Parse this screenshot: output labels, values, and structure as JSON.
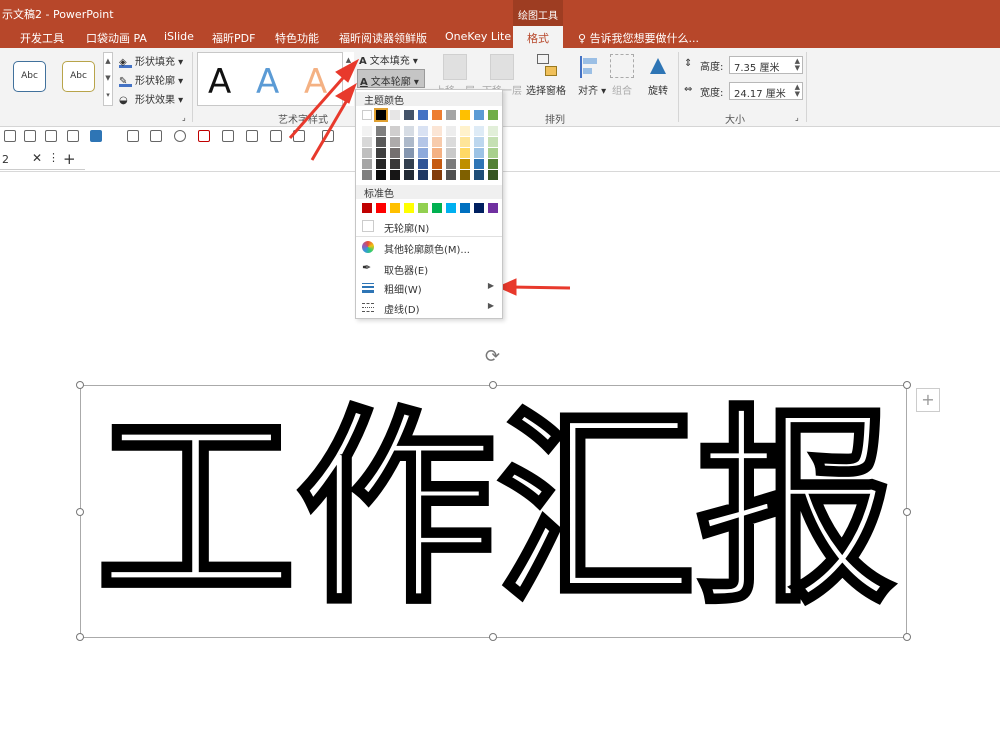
{
  "titlebar": {
    "title": "示文稿2 - PowerPoint",
    "context_group": "绘图工具"
  },
  "tabs": [
    "开发工具",
    "口袋动画 PA",
    "iSlide",
    "福昕PDF",
    "特色功能",
    "福昕阅读器领鲜版",
    "OneKey Lite"
  ],
  "active_tab": "格式",
  "tell_me": "告诉我您想要做什么...",
  "ribbon": {
    "shape_styles": {
      "sample1": "Abc",
      "sample2": "Abc",
      "fill": "形状填充",
      "outline": "形状轮廓",
      "effects": "形状效果"
    },
    "wordart": {
      "letter": "A",
      "label": "艺术字样式",
      "text_fill": "文本填充",
      "text_outline": "文本轮廓"
    },
    "arrange": {
      "bring_forward": "上移一层",
      "send_backward": "下移一层",
      "selection_pane": "选择窗格",
      "align": "对齐",
      "group": "组合",
      "rotate": "旋转",
      "label": "排列"
    },
    "size": {
      "height_label": "高度:",
      "height_value": "7.35 厘米",
      "width_label": "宽度:",
      "width_value": "24.17 厘米",
      "label": "大小"
    }
  },
  "doc_tab": {
    "name": "2"
  },
  "menu": {
    "theme_header": "主题颜色",
    "standard_header": "标准色",
    "theme_top": [
      "#ffffff",
      "#000000",
      "#e7e6e6",
      "#44546a",
      "#4472c4",
      "#ed7d31",
      "#a5a5a5",
      "#ffc000",
      "#5b9bd5",
      "#70ad47"
    ],
    "theme_shades": [
      [
        "#f2f2f2",
        "#7f7f7f",
        "#d0cece",
        "#d6dce4",
        "#d9e2f3",
        "#fbe5d5",
        "#ededed",
        "#fff2cc",
        "#deebf6",
        "#e2efd9"
      ],
      [
        "#d8d8d8",
        "#595959",
        "#aeabab",
        "#adb9ca",
        "#b4c6e7",
        "#f7cbac",
        "#dbdbdb",
        "#fee599",
        "#bdd7ee",
        "#c5e0b3"
      ],
      [
        "#bfbfbf",
        "#3f3f3f",
        "#757070",
        "#8496b0",
        "#8eaadb",
        "#f4b183",
        "#c9c9c9",
        "#ffd965",
        "#9cc3e5",
        "#a8d08d"
      ],
      [
        "#a5a5a5",
        "#262626",
        "#3a3838",
        "#323f4f",
        "#2f5496",
        "#c55a11",
        "#7b7b7b",
        "#bf8f00",
        "#2e75b5",
        "#538135"
      ],
      [
        "#7f7f7f",
        "#0c0c0c",
        "#171616",
        "#222a35",
        "#1f3864",
        "#833c0b",
        "#525252",
        "#7f6000",
        "#1e4e79",
        "#375623"
      ]
    ],
    "standard": [
      "#c00000",
      "#ff0000",
      "#ffc000",
      "#ffff00",
      "#92d050",
      "#00b050",
      "#00b0f0",
      "#0070c0",
      "#002060",
      "#7030a0"
    ],
    "items": [
      {
        "label": "无轮廓(N)"
      },
      {
        "label": "其他轮廓颜色(M)..."
      },
      {
        "label": "取色器(E)"
      },
      {
        "label": "粗细(W)"
      },
      {
        "label": "虚线(D)"
      }
    ]
  },
  "slide": {
    "text": "工作汇报"
  }
}
